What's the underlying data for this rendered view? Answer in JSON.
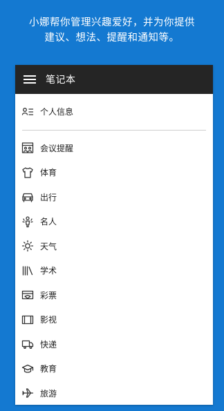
{
  "banner": {
    "line1": "小娜帮你管理兴趣爱好，并为你提供",
    "line2": "建议、想法、提醒和通知等。"
  },
  "titlebar": {
    "title": "笔记本"
  },
  "profile": {
    "label": "个人信息",
    "icon": "person-list-icon"
  },
  "items": [
    {
      "label": "会议提醒",
      "icon": "meeting-icon"
    },
    {
      "label": "体育",
      "icon": "jersey-icon"
    },
    {
      "label": "出行",
      "icon": "car-icon"
    },
    {
      "label": "名人",
      "icon": "celebrity-icon"
    },
    {
      "label": "天气",
      "icon": "sun-icon"
    },
    {
      "label": "学术",
      "icon": "books-icon"
    },
    {
      "label": "彩票",
      "icon": "lottery-icon"
    },
    {
      "label": "影视",
      "icon": "film-icon"
    },
    {
      "label": "快递",
      "icon": "truck-icon"
    },
    {
      "label": "教育",
      "icon": "graduation-cap-icon"
    },
    {
      "label": "旅游",
      "icon": "airplane-icon"
    }
  ],
  "colors": {
    "background": "#1479d1",
    "titlebar": "#252525",
    "panel": "#ffffff"
  }
}
